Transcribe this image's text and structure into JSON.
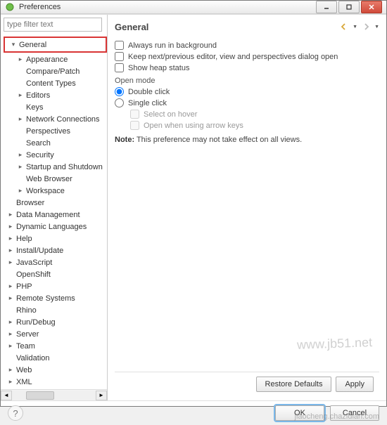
{
  "window": {
    "title": "Preferences"
  },
  "sidebar": {
    "filter_placeholder": "type filter text",
    "items": [
      {
        "label": "General",
        "level": 0,
        "expandable": true,
        "expanded": true,
        "selected": true
      },
      {
        "label": "Appearance",
        "level": 1,
        "expandable": true
      },
      {
        "label": "Compare/Patch",
        "level": 1,
        "expandable": false
      },
      {
        "label": "Content Types",
        "level": 1,
        "expandable": false
      },
      {
        "label": "Editors",
        "level": 1,
        "expandable": true
      },
      {
        "label": "Keys",
        "level": 1,
        "expandable": false
      },
      {
        "label": "Network Connections",
        "level": 1,
        "expandable": true
      },
      {
        "label": "Perspectives",
        "level": 1,
        "expandable": false
      },
      {
        "label": "Search",
        "level": 1,
        "expandable": false
      },
      {
        "label": "Security",
        "level": 1,
        "expandable": true
      },
      {
        "label": "Startup and Shutdown",
        "level": 1,
        "expandable": true
      },
      {
        "label": "Web Browser",
        "level": 1,
        "expandable": false
      },
      {
        "label": "Workspace",
        "level": 1,
        "expandable": true
      },
      {
        "label": "Browser",
        "level": 0,
        "expandable": false
      },
      {
        "label": "Data Management",
        "level": 0,
        "expandable": true
      },
      {
        "label": "Dynamic Languages",
        "level": 0,
        "expandable": true
      },
      {
        "label": "Help",
        "level": 0,
        "expandable": true
      },
      {
        "label": "Install/Update",
        "level": 0,
        "expandable": true
      },
      {
        "label": "JavaScript",
        "level": 0,
        "expandable": true
      },
      {
        "label": "OpenShift",
        "level": 0,
        "expandable": false
      },
      {
        "label": "PHP",
        "level": 0,
        "expandable": true
      },
      {
        "label": "Remote Systems",
        "level": 0,
        "expandable": true
      },
      {
        "label": "Rhino",
        "level": 0,
        "expandable": false
      },
      {
        "label": "Run/Debug",
        "level": 0,
        "expandable": true
      },
      {
        "label": "Server",
        "level": 0,
        "expandable": true
      },
      {
        "label": "Team",
        "level": 0,
        "expandable": true
      },
      {
        "label": "Validation",
        "level": 0,
        "expandable": false
      },
      {
        "label": "Web",
        "level": 0,
        "expandable": true
      },
      {
        "label": "XML",
        "level": 0,
        "expandable": true
      }
    ]
  },
  "content": {
    "heading": "General",
    "always_run_bg": "Always run in background",
    "keep_dialog_open": "Keep next/previous editor, view and perspectives dialog open",
    "show_heap": "Show heap status",
    "open_mode": "Open mode",
    "double_click": "Double click",
    "single_click": "Single click",
    "select_hover": "Select on hover",
    "open_arrow": "Open when using arrow keys",
    "note_label": "Note:",
    "note_text": " This preference may not take effect on all views."
  },
  "buttons": {
    "restore": "Restore Defaults",
    "apply": "Apply",
    "ok": "OK",
    "cancel": "Cancel"
  }
}
